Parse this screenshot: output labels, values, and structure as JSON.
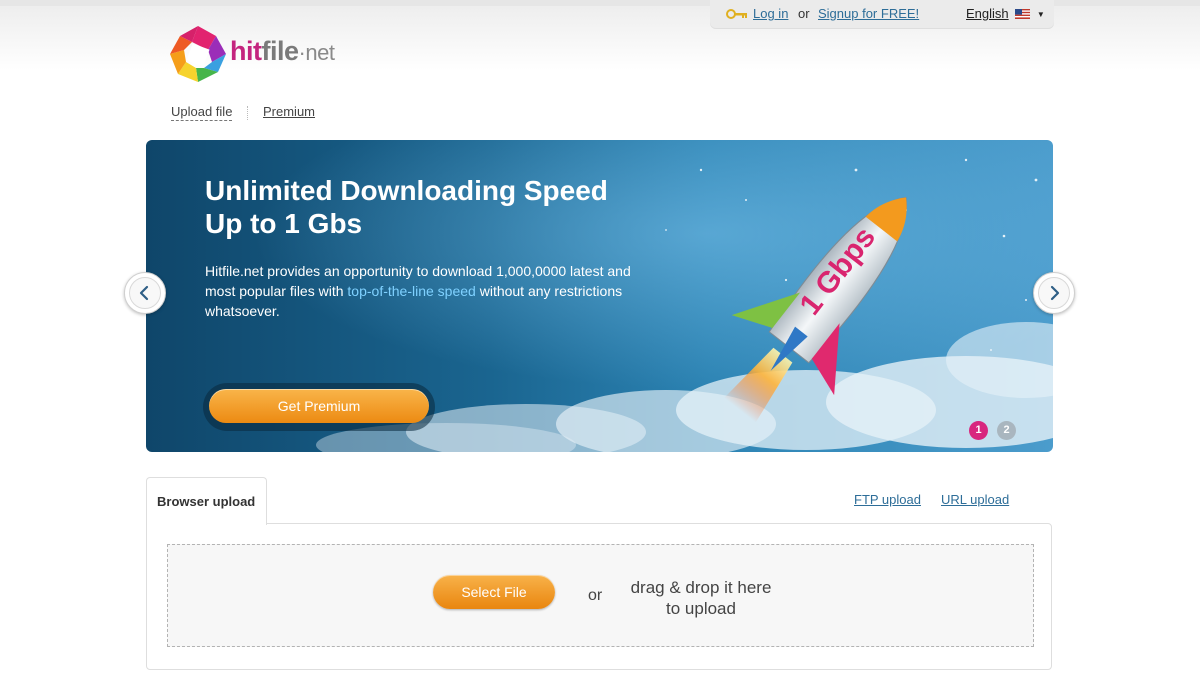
{
  "header": {
    "login_label": "Log in",
    "or_label": "or",
    "signup_label": "Signup for FREE!",
    "language_label": "English"
  },
  "logo": {
    "part_hit": "hit",
    "part_file": "file",
    "part_net": "·net"
  },
  "nav": {
    "upload_label": "Upload file",
    "premium_label": "Premium"
  },
  "banner": {
    "title_line1": "Unlimited Downloading Speed",
    "title_line2": "Up to 1 Gbs",
    "description_before": "Hitfile.net provides an opportunity to download 1,000,0000 latest and most popular files with ",
    "description_highlight": "top-of-the-line speed",
    "description_after": " without any restrictions whatsoever.",
    "rocket_label": "1 Gbps",
    "cta_label": "Get Premium",
    "slides": [
      "1",
      "2"
    ],
    "active_slide": 1
  },
  "upload": {
    "active_tab": "Browser upload",
    "ftp_label": "FTP upload",
    "url_label": "URL upload",
    "select_label": "Select File",
    "or_label": "or",
    "drop_line1": "drag & drop it here",
    "drop_line2": "to upload"
  },
  "colors": {
    "link": "#2d6d98",
    "brand_magenta": "#c4247e",
    "button_orange": "#ec8a12",
    "active_dot": "#d8267e"
  }
}
